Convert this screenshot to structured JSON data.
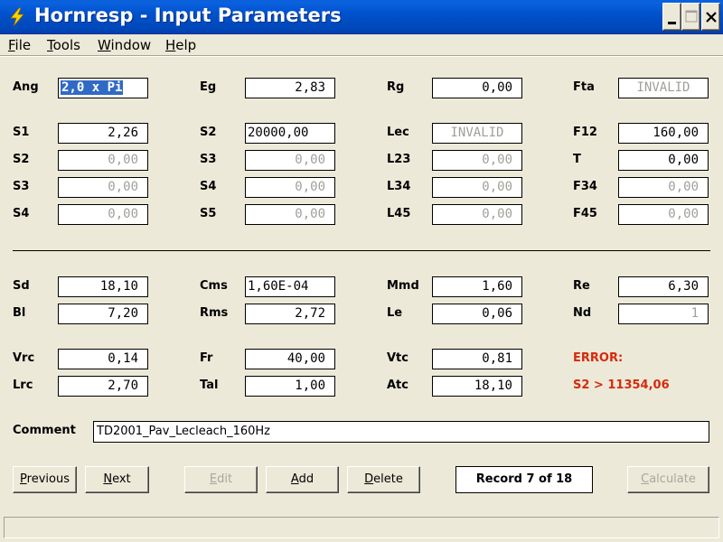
{
  "window": {
    "title": "Hornresp - Input Parameters",
    "title_bar_color": "#0052CC"
  },
  "menu": [
    {
      "key": "F",
      "rest": "ile"
    },
    {
      "key": "T",
      "rest": "ools"
    },
    {
      "key": "W",
      "rest": "indow"
    },
    {
      "key": "H",
      "rest": "elp"
    }
  ],
  "params": {
    "ang": {
      "label": "Ang",
      "value": "2,0 x Pi"
    },
    "eg": {
      "label": "Eg",
      "value": "2,83"
    },
    "rg": {
      "label": "Rg",
      "value": "0,00"
    },
    "fta": {
      "label": "Fta",
      "value": "INVALID"
    },
    "s1": {
      "label": "S1",
      "value": "2,26"
    },
    "s2": {
      "label": "S2",
      "value": "20000,00"
    },
    "lec": {
      "label": "Lec",
      "value": "INVALID"
    },
    "f12": {
      "label": "F12",
      "value": "160,00"
    },
    "s2b": {
      "label": "S2",
      "value": "0,00"
    },
    "s3": {
      "label": "S3",
      "value": "0,00"
    },
    "l23": {
      "label": "L23",
      "value": "0,00"
    },
    "t": {
      "label": "T",
      "value": "0,00"
    },
    "s3b": {
      "label": "S3",
      "value": "0,00"
    },
    "s4": {
      "label": "S4",
      "value": "0,00"
    },
    "l34": {
      "label": "L34",
      "value": "0,00"
    },
    "f34": {
      "label": "F34",
      "value": "0,00"
    },
    "s4b": {
      "label": "S4",
      "value": "0,00"
    },
    "s5": {
      "label": "S5",
      "value": "0,00"
    },
    "l45": {
      "label": "L45",
      "value": "0,00"
    },
    "f45": {
      "label": "F45",
      "value": "0,00"
    },
    "sd": {
      "label": "Sd",
      "value": "18,10"
    },
    "cms": {
      "label": "Cms",
      "value": "1,60E-04"
    },
    "mmd": {
      "label": "Mmd",
      "value": "1,60"
    },
    "re": {
      "label": "Re",
      "value": "6,30"
    },
    "bl": {
      "label": "Bl",
      "value": "7,20"
    },
    "rms": {
      "label": "Rms",
      "value": "2,72"
    },
    "le": {
      "label": "Le",
      "value": "0,06"
    },
    "nd": {
      "label": "Nd",
      "value": "1"
    },
    "vrc": {
      "label": "Vrc",
      "value": "0,14"
    },
    "fr": {
      "label": "Fr",
      "value": "40,00"
    },
    "vtc": {
      "label": "Vtc",
      "value": "0,81"
    },
    "lrc": {
      "label": "Lrc",
      "value": "2,70"
    },
    "tal": {
      "label": "Tal",
      "value": "1,00"
    },
    "atc": {
      "label": "Atc",
      "value": "18,10"
    }
  },
  "error": {
    "title": "ERROR:",
    "message": "S2 > 11354,06",
    "color": "#D52A0E"
  },
  "comment": {
    "label": "Comment",
    "value": "TD2001_Pav_Lecleach_160Hz"
  },
  "buttons": {
    "previous": {
      "key": "P",
      "rest": "revious"
    },
    "next": {
      "key": "N",
      "rest": "ext"
    },
    "edit": {
      "key": "E",
      "rest": "dit"
    },
    "add": {
      "key": "A",
      "rest": "dd"
    },
    "delete": {
      "key": "D",
      "rest": "elete"
    },
    "calculate": {
      "key": "C",
      "rest": "alculate"
    }
  },
  "record": "Record 7 of 18",
  "status": ""
}
